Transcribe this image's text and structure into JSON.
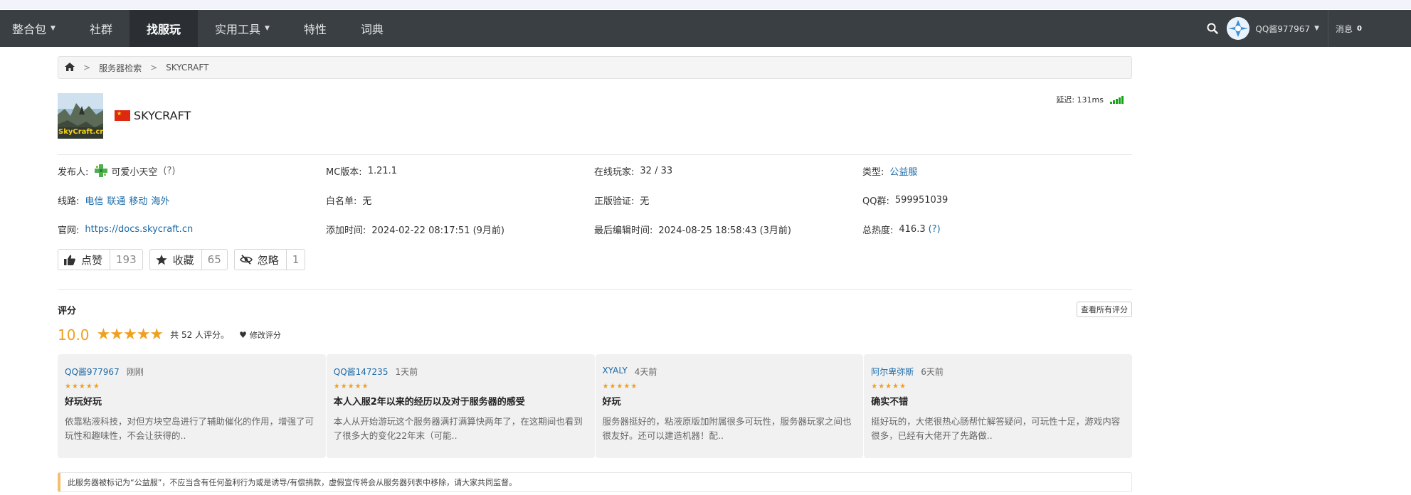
{
  "nav": {
    "items": [
      {
        "label": "整合包",
        "caret": true
      },
      {
        "label": "社群",
        "caret": false
      },
      {
        "label": "找服玩",
        "caret": false,
        "active": true
      },
      {
        "label": "实用工具",
        "caret": true
      },
      {
        "label": "特性",
        "caret": false
      },
      {
        "label": "词典",
        "caret": false
      }
    ],
    "user": "QQ酱977967",
    "messages_label": "消息",
    "messages_count": "0"
  },
  "breadcrumb": {
    "level1": "服务器检索",
    "level2": "SKYCRAFT"
  },
  "server": {
    "logo_text": "SkyCraft.cn",
    "name": "SKYCRAFT",
    "ping_label": "延迟: 131ms"
  },
  "info": {
    "publisher_label": "发布人:",
    "publisher": "可爱小天空",
    "publisher_hint": "(?)",
    "mc_version_label": "MC版本:",
    "mc_version": "1.21.1",
    "online_label": "在线玩家:",
    "online": "32 / 33",
    "type_label": "类型:",
    "type": "公益服",
    "lines_label": "线路:",
    "lines": [
      "电信",
      "联通",
      "移动",
      "海外"
    ],
    "whitelist_label": "白名单:",
    "whitelist": "无",
    "genuine_label": "正版验证:",
    "genuine": "无",
    "qq_label": "QQ群:",
    "qq": "599951039",
    "site_label": "官网:",
    "site": "https://docs.skycraft.cn",
    "added_label": "添加时间:",
    "added": "2024-02-22 08:17:51 (9月前)",
    "edited_label": "最后编辑时间:",
    "edited": "2024-08-25 18:58:43 (3月前)",
    "heat_label": "总热度:",
    "heat": "416.3",
    "heat_hint": "(?)"
  },
  "actions": {
    "like_label": "点赞",
    "like_count": "193",
    "fav_label": "收藏",
    "fav_count": "65",
    "ignore_label": "忽略",
    "ignore_count": "1"
  },
  "rating": {
    "title": "评分",
    "view_all": "查看所有评分",
    "score": "10.0",
    "stars": "★★★★★",
    "count_text": "共 52 人评分。",
    "edit_label": "修改评分"
  },
  "reviews": [
    {
      "user": "QQ酱977967",
      "time": "刚刚",
      "stars": "★★★★★",
      "title": "好玩好玩",
      "body": "依靠粘液科技，对但方块空岛进行了辅助催化的作用，增强了可玩性和趣味性，不会让获得的.."
    },
    {
      "user": "QQ酱147235",
      "time": "1天前",
      "stars": "★★★★★",
      "title": "本人入服2年以来的经历以及对于服务器的感受",
      "body": "本人从开始游玩这个服务器满打满算快两年了，在这期间也看到了很多大的变化22年末（可能.."
    },
    {
      "user": "XYALY",
      "time": "4天前",
      "stars": "★★★★★",
      "title": "好玩",
      "body": "服务器挺好的，粘液原版加附属很多可玩性，服务器玩家之间也很友好。还可以建造机器！配.."
    },
    {
      "user": "阿尔卑弥斯",
      "time": "6天前",
      "stars": "★★★★★",
      "title": "确实不错",
      "body": "挺好玩的，大佬很热心肠帮忙解答疑问，可玩性十足，游戏内容很多，已经有大佬开了先路做.."
    }
  ],
  "notice": "此服务器被标记为“公益服”，不应当含有任何盈利行为或是诱导/有偿捐款，虚假宣传将会从服务器列表中移除，请大家共同监督。"
}
